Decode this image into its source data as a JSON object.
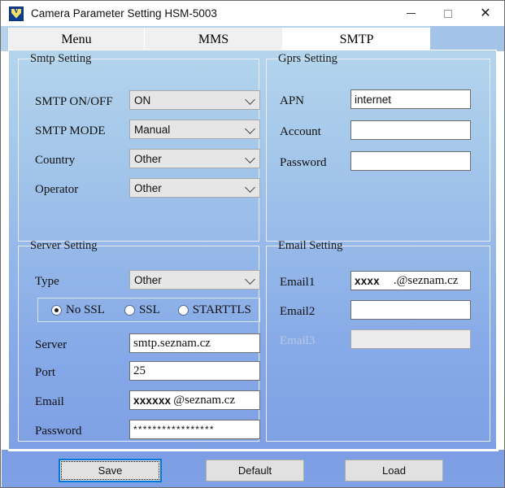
{
  "window": {
    "title": "Camera Parameter Setting HSM-5003",
    "icon": "app-shield-icon",
    "controls": {
      "minimize": "—",
      "maximize": "□",
      "close": "✕"
    }
  },
  "tabs": [
    {
      "label": "Menu",
      "active": false
    },
    {
      "label": "MMS",
      "active": false
    },
    {
      "label": "SMTP",
      "active": true
    }
  ],
  "groups": {
    "smtp_setting": {
      "title": "Smtp Setting",
      "rows": [
        {
          "label": "SMTP ON/OFF",
          "value": "ON"
        },
        {
          "label": "SMTP MODE",
          "value": "Manual"
        },
        {
          "label": "Country",
          "value": "Other"
        },
        {
          "label": "Operator",
          "value": "Other"
        }
      ]
    },
    "gprs_setting": {
      "title": "Gprs Setting",
      "rows": [
        {
          "label": "APN",
          "value": "internet"
        },
        {
          "label": "Account",
          "value": ""
        },
        {
          "label": "Password",
          "value": ""
        }
      ]
    },
    "server_setting": {
      "title": "Server Setting",
      "type_label": "Type",
      "type_value": "Other",
      "ssl_options": [
        {
          "label": "No SSL",
          "checked": true
        },
        {
          "label": "SSL",
          "checked": false
        },
        {
          "label": "STARTTLS",
          "checked": false
        }
      ],
      "rows": [
        {
          "label": "Server",
          "value": "smtp.seznam.cz"
        },
        {
          "label": "Port",
          "value": "25"
        }
      ],
      "email_label": "Email",
      "email_user": "xxxxxx",
      "email_domain": "@seznam.cz",
      "password_label": "Password",
      "password_value": "*****************"
    },
    "email_setting": {
      "title": "Email Setting",
      "email1_label": "Email1",
      "email1_user": "xxxx",
      "email1_domain": ".@seznam.cz",
      "email2_label": "Email2",
      "email2_value": "",
      "email3_label": "Email3",
      "email3_value": "",
      "email3_disabled": true
    }
  },
  "footer": {
    "save_label": "Save",
    "default_label": "Default",
    "load_label": "Load"
  },
  "colors": {
    "tabstrip": "#b5d3ea",
    "tab_right_fill": "#a3c4e8",
    "page_top": "#b4d5ec",
    "page_bottom": "#7fa0e4",
    "focus_border": "#0078d7",
    "button_face": "#e1e1e1",
    "combo_face": "#e6e6e6"
  }
}
